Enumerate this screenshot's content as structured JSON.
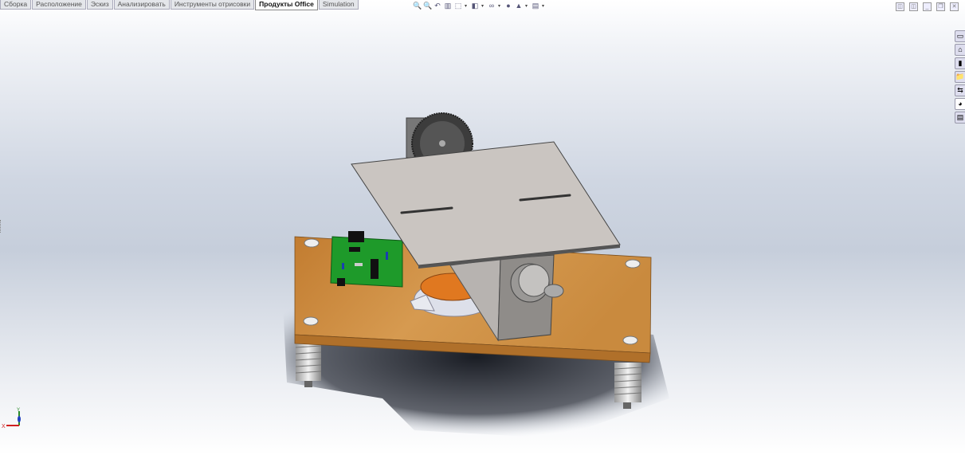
{
  "tabs": [
    "Сборка",
    "Расположение",
    "Эскиз",
    "Анализировать",
    "Инструменты отрисовки",
    "Продукты Office",
    "Simulation"
  ],
  "active_tab": "Продукты Office",
  "toolbar": [
    {
      "icon": "zoom-to-fit-icon",
      "glyph": "🔍"
    },
    {
      "icon": "zoom-to-area-icon",
      "glyph": "🔍"
    },
    {
      "icon": "previous-view-icon",
      "glyph": "↶"
    },
    {
      "icon": "section-view-icon",
      "glyph": "▥"
    },
    {
      "icon": "view-orientation-icon",
      "glyph": "⬚"
    },
    {
      "icon": "display-style-icon",
      "glyph": "◧"
    },
    {
      "icon": "hide-show-items-icon",
      "glyph": "∞"
    },
    {
      "icon": "edit-appearance-icon",
      "glyph": "●"
    },
    {
      "icon": "apply-scene-icon",
      "glyph": "▲"
    },
    {
      "icon": "view-settings-icon",
      "glyph": "▤"
    }
  ],
  "window_controls": [
    {
      "icon": "tile-horizontal-icon",
      "glyph": "◫"
    },
    {
      "icon": "tile-vertical-icon",
      "glyph": "◫"
    },
    {
      "icon": "minimize-icon",
      "glyph": "_"
    },
    {
      "icon": "restore-icon",
      "glyph": "❐"
    },
    {
      "icon": "close-icon",
      "glyph": "✕"
    }
  ],
  "task_pane": [
    {
      "icon": "solidworks-resources-icon",
      "glyph": "▭"
    },
    {
      "icon": "design-library-icon",
      "glyph": "⌂"
    },
    {
      "icon": "file-explorer-icon",
      "glyph": "▮"
    },
    {
      "icon": "folder-icon",
      "glyph": "📁"
    },
    {
      "icon": "view-palette-icon",
      "glyph": "⇆"
    },
    {
      "icon": "appearances-icon",
      "glyph": "◕"
    },
    {
      "icon": "custom-properties-icon",
      "glyph": "▤"
    }
  ],
  "triad": {
    "x": "X",
    "y": "Y"
  },
  "colors": {
    "wood": "#c98a3e",
    "plate": "#c9c4c0",
    "pcb": "#1e9a2a"
  }
}
